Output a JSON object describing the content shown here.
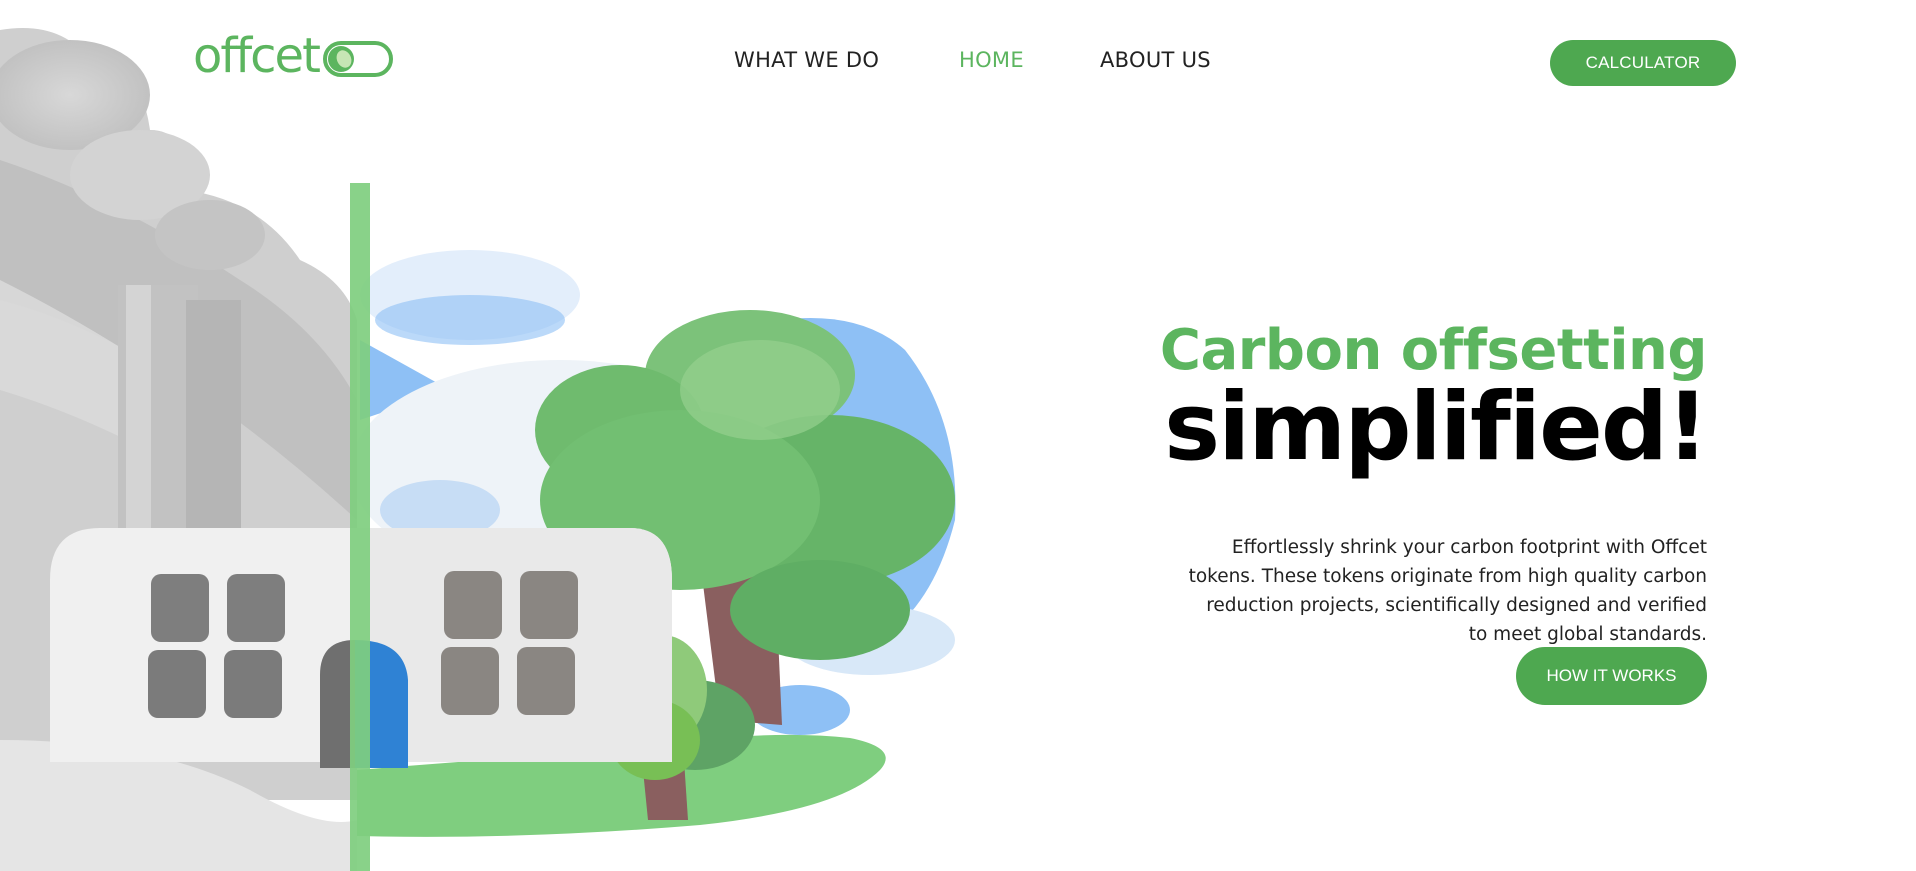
{
  "brand": {
    "logo_text": "offcet",
    "accent": "#5cb55f"
  },
  "nav": {
    "items": [
      {
        "label": "WHAT WE DO",
        "active": false
      },
      {
        "label": "HOME",
        "active": true
      },
      {
        "label": "ABOUT US",
        "active": false
      }
    ]
  },
  "header": {
    "calculator_label": "CALCULATOR"
  },
  "hero": {
    "headline_line1": "Carbon offsetting",
    "headline_line2": "simplified!",
    "description": "Effortlessly shrink your carbon footprint with Offcet tokens. These tokens originate from high quality carbon reduction projects, scientifically designed and verified to meet global standards.",
    "cta_label": "HOW IT WORKS"
  },
  "colors": {
    "button": "#4ea850",
    "sky": "#8ec0f5",
    "grass": "#7fce7f",
    "smoke": "#c9c9c9"
  },
  "illustration": {
    "left_half": "grey polluting factory",
    "right_half": "green eco building with trees"
  }
}
